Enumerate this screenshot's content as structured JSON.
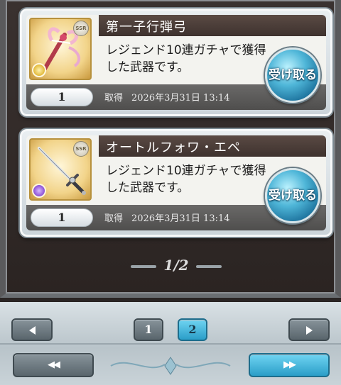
{
  "cards": [
    {
      "name": "第一子行弾弓",
      "description": "レジェンド10連ガチャで獲得した武器です。",
      "quantity": "1",
      "obtained_label": "取得",
      "obtained_date": "2026年3月31日 13:14",
      "receive_label": "受け取る",
      "rarity": "SSR",
      "element_color": "#e2b93a"
    },
    {
      "name": "オートルフォワ・エペ",
      "description": "レジェンド10連ガチャで獲得した武器です。",
      "quantity": "1",
      "obtained_label": "取得",
      "obtained_date": "2026年3月31日 13:14",
      "receive_label": "受け取る",
      "rarity": "SSR",
      "element_color": "#8b4fd4"
    }
  ],
  "pager": {
    "text": "1/2"
  },
  "nav": {
    "pages": [
      {
        "label": "1",
        "active": false
      },
      {
        "label": "2",
        "active": true
      }
    ],
    "prev_icon": "triangle-left-icon",
    "next_icon": "triangle-right-icon",
    "first_label": "◀◀",
    "last_label": "▶▶"
  }
}
